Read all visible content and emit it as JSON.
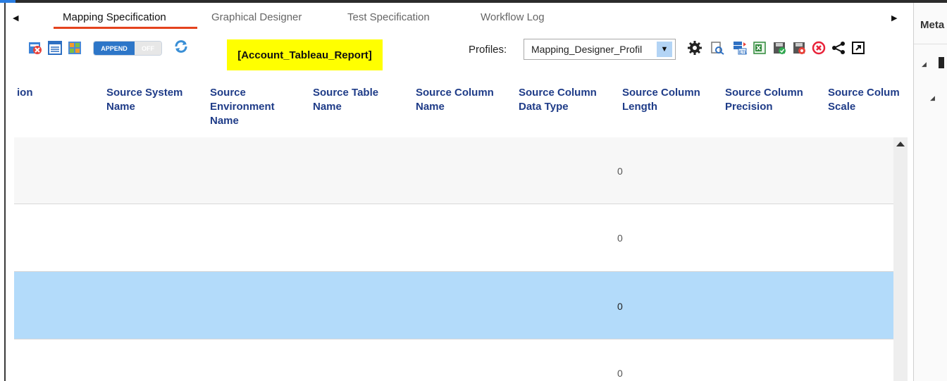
{
  "tabs": {
    "items": [
      {
        "label": "Mapping Specification",
        "active": true
      },
      {
        "label": "Graphical Designer",
        "active": false
      },
      {
        "label": "Test Specification",
        "active": false
      },
      {
        "label": "Workflow Log",
        "active": false
      }
    ],
    "scroll_left_icon": "triangle-left-icon",
    "scroll_right_icon": "triangle-right-icon"
  },
  "toolbar": {
    "icons": [
      "delete-mapping-icon",
      "properties-icon",
      "import-icon"
    ],
    "append_on": "APPEND",
    "append_off": "OFF",
    "refresh_icon": "refresh-icon",
    "report_name": "[Account_Tableau_Report]",
    "profiles_label": "Profiles:",
    "profiles_value": "Mapping_Designer_Profil",
    "right_icons": [
      "settings-gear-icon",
      "preview-icon",
      "etl-icon",
      "excel-export-icon",
      "save-green-icon",
      "save-red-icon",
      "close-circle-icon",
      "share-icon",
      "popout-icon"
    ]
  },
  "grid": {
    "columns": [
      [
        "ion"
      ],
      [
        "Source System",
        "Name"
      ],
      [
        "Source",
        "Environment",
        "Name"
      ],
      [
        "Source Table",
        "Name"
      ],
      [
        "Source Column",
        "Name"
      ],
      [
        "Source Column",
        "Data Type"
      ],
      [
        "Source Column",
        "Length"
      ],
      [
        "Source Column",
        "Precision"
      ],
      [
        "Source Colum",
        "Scale"
      ]
    ],
    "rows": [
      {
        "length": "0",
        "selected": false
      },
      {
        "length": "0",
        "selected": false
      },
      {
        "length": "0",
        "selected": true
      },
      {
        "length": "0",
        "selected": false
      }
    ]
  },
  "right_panel": {
    "title": "Meta"
  },
  "colors": {
    "header_text": "#1f3c88",
    "active_tab_underline": "#e4431e",
    "selected_row": "#b3dbfa",
    "report_highlight": "#ffff00",
    "append_toggle": "#2d76c8"
  }
}
